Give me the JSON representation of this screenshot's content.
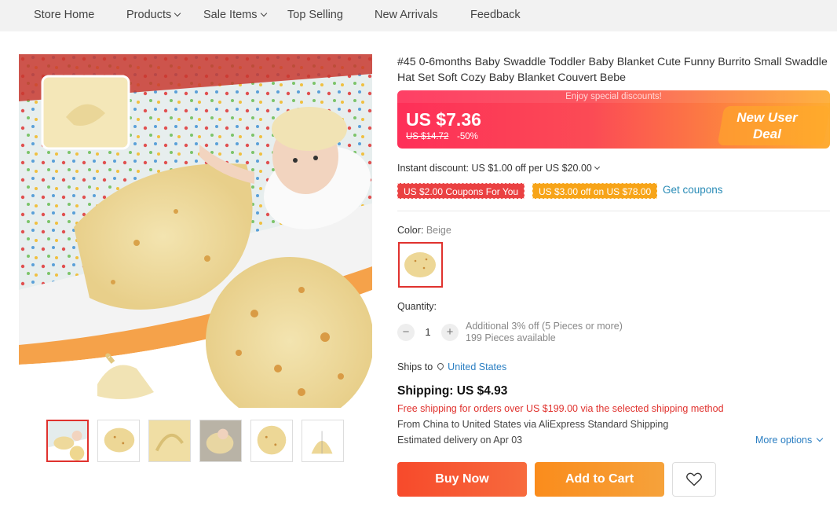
{
  "nav": {
    "items": [
      {
        "label": "Store Home"
      },
      {
        "label": "Products"
      },
      {
        "label": "Sale Items"
      },
      {
        "label": "Top Selling"
      },
      {
        "label": "New Arrivals"
      },
      {
        "label": "Feedback"
      }
    ]
  },
  "product": {
    "title": "#45 0-6months Baby Swaddle Toddler Baby Blanket Cute Funny Burrito Small Swaddle Hat Set Soft Cozy Baby Blanket Couvert Bebe",
    "banner": "Enjoy special discounts!",
    "price": "US $7.36",
    "old_price": "US $14.72",
    "discount": "-50%",
    "deal_badge": "New User Deal"
  },
  "instant_discount": "Instant discount: US $1.00 off per US $20.00",
  "coupons": {
    "coupon1": "US $2.00 Coupons For You",
    "coupon2": "US $3.00 off on US $78.00",
    "get_coupons": "Get coupons"
  },
  "color": {
    "label": "Color:",
    "value": "Beige"
  },
  "quantity": {
    "label": "Quantity:",
    "value": "1",
    "minus": "−",
    "plus": "+",
    "offer": "Additional 3% off (5 Pieces or more)",
    "available": "199 Pieces available"
  },
  "ships": {
    "label": "Ships to",
    "country": "United States"
  },
  "shipping": {
    "title": "Shipping: US $4.93",
    "free_note": "Free shipping for orders over US $199.00 via the selected shipping method",
    "from": "From China to United States via AliExpress Standard Shipping",
    "delivery": "Estimated delivery on Apr 03",
    "more_options": "More options"
  },
  "buttons": {
    "buy_now": "Buy Now",
    "add_to_cart": "Add to Cart"
  },
  "icons": {
    "wishlist": "heart-icon",
    "location": "pin-icon"
  },
  "colors": {
    "accent_red": "#e0322e",
    "link_blue": "#2a7ec2",
    "buy": "#f74a2b",
    "cart": "#fa8c1c"
  }
}
